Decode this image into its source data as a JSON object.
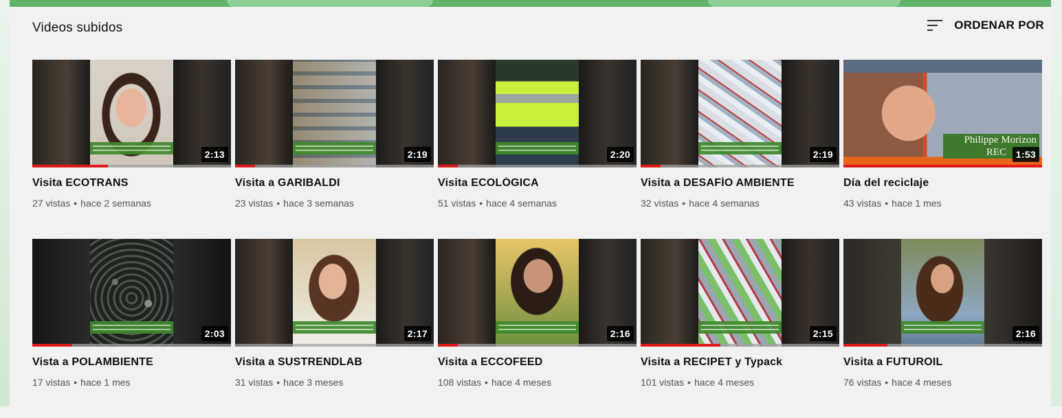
{
  "section": {
    "title": "Videos subidos",
    "sort_label": "ORDENAR POR",
    "sort_icon": "sort-icon"
  },
  "colors": {
    "progress": "#e01a1a",
    "caption_green": "#3f8a2c"
  },
  "videos": [
    {
      "title": "Visita ECOTRANS",
      "views": "27 vistas",
      "age": "hace 2 semanas",
      "duration": "2:13",
      "watched": 0.38,
      "theme": "person-woman"
    },
    {
      "title": "Visita a GARIBALDI",
      "views": "23 vistas",
      "age": "hace 3 semanas",
      "duration": "2:19",
      "watched": 0.1,
      "theme": "bales"
    },
    {
      "title": "Visita ECOLÓGICA",
      "views": "51 vistas",
      "age": "hace 4 semanas",
      "duration": "2:20",
      "watched": 0.1,
      "theme": "worker-vest"
    },
    {
      "title": "Visita a DESAFÍO AMBIENTE",
      "views": "32 vistas",
      "age": "hace 4 semanas",
      "duration": "2:19",
      "watched": 0.1,
      "theme": "plastic"
    },
    {
      "title": "Día del reciclaje",
      "views": "43 vistas",
      "age": "hace 1 mes",
      "duration": "1:53",
      "watched": 1.0,
      "theme": "man-helmet",
      "overlay_text": "Philippe Morizon",
      "overlay_text2": "REC"
    },
    {
      "title": "Vista a POLAMBIENTE",
      "views": "17 vistas",
      "age": "hace 1 mes",
      "duration": "2:03",
      "watched": 0.2,
      "theme": "rubber"
    },
    {
      "title": "Visita a SUSTRENDLAB",
      "views": "31 vistas",
      "age": "hace 3 meses",
      "duration": "2:17",
      "watched": 0.0,
      "theme": "person-woman2"
    },
    {
      "title": "Visita a ECCOFEED",
      "views": "108 vistas",
      "age": "hace 4 meses",
      "duration": "2:16",
      "watched": 0.1,
      "theme": "person-woman3"
    },
    {
      "title": "Visita a RECIPET y Typack",
      "views": "101 vistas",
      "age": "hace 4 meses",
      "duration": "2:15",
      "watched": 0.4,
      "theme": "plastic2"
    },
    {
      "title": "Visita a FUTUROIL",
      "views": "76 vistas",
      "age": "hace 4 meses",
      "duration": "2:16",
      "watched": 0.22,
      "theme": "person-woman4"
    }
  ]
}
